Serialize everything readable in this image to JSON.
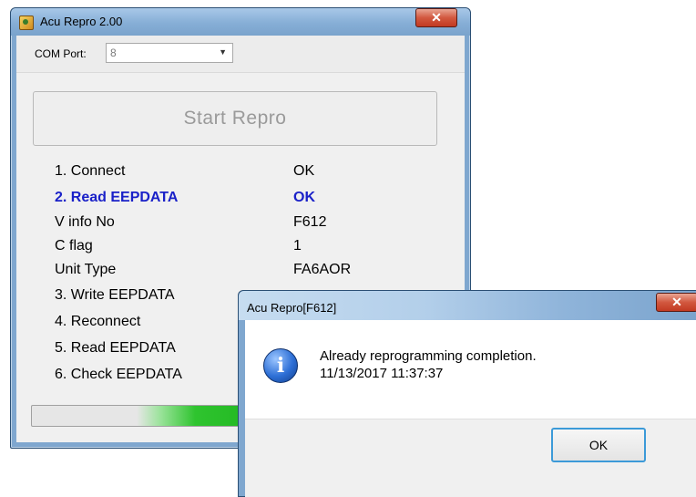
{
  "main_window": {
    "title": "Acu Repro 2.00",
    "close_glyph": "✕",
    "com_port": {
      "label": "COM Port:",
      "value": "8"
    },
    "start_button": "Start Repro",
    "steps": [
      {
        "label": "1. Connect",
        "value": "OK"
      },
      {
        "label": "2. Read EEPDATA",
        "value": "OK"
      },
      {
        "label": "V info No",
        "value": "F612"
      },
      {
        "label": "C flag",
        "value": "1"
      },
      {
        "label": "Unit Type",
        "value": "FA6AOR"
      },
      {
        "label": "3. Write EEPDATA",
        "value": ""
      },
      {
        "label": "4. Reconnect",
        "value": ""
      },
      {
        "label": "5. Read EEPDATA",
        "value": ""
      },
      {
        "label": "6. Check EEPDATA",
        "value": ""
      }
    ],
    "highlight_color": "#1a21c8",
    "progress_fraction": 0.78
  },
  "dialog": {
    "title": "Acu Repro[F612]",
    "close_glyph": "✕",
    "icon": "info-icon",
    "message_line1": "Already reprogramming completion.",
    "message_line2": "11/13/2017 11:37:37",
    "ok_button": "OK"
  }
}
